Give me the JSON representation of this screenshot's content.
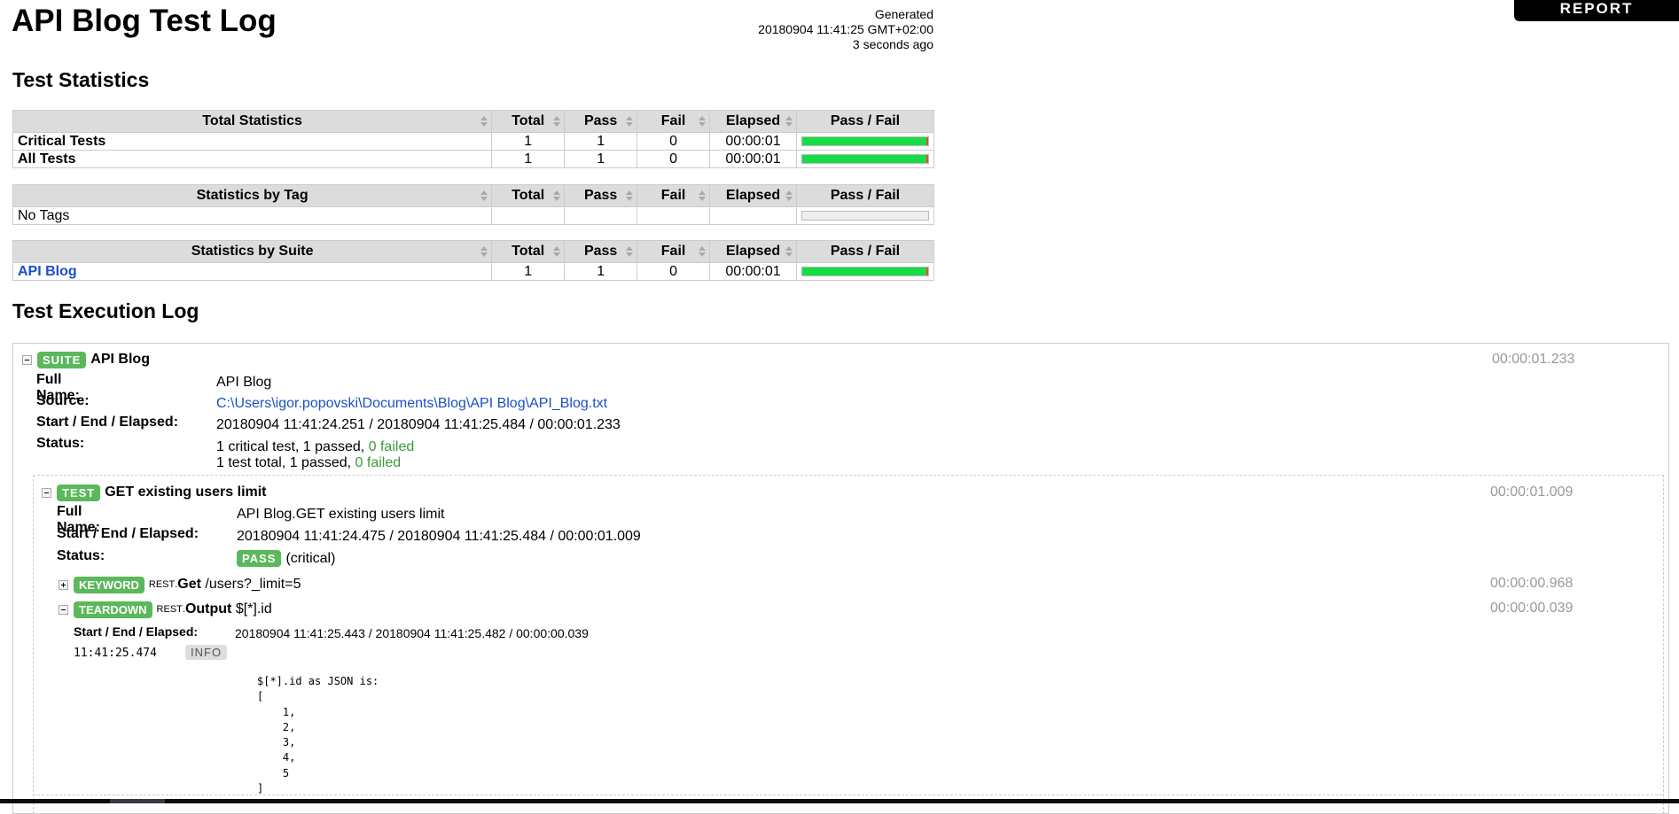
{
  "header": {
    "title": "API Blog Test Log",
    "generated_label": "Generated",
    "generated_timestamp": "20180904 11:41:25 GMT+02:00",
    "generated_ago": "3 seconds ago",
    "report_link": "REPORT"
  },
  "statistics": {
    "heading": "Test Statistics",
    "columns": [
      "Total",
      "Pass",
      "Fail",
      "Elapsed",
      "Pass / Fail"
    ],
    "total": {
      "title": "Total Statistics",
      "rows": [
        {
          "name": "Critical Tests",
          "total": "1",
          "pass": "1",
          "fail": "0",
          "elapsed": "00:00:01",
          "pass_fraction": 1.0
        },
        {
          "name": "All Tests",
          "total": "1",
          "pass": "1",
          "fail": "0",
          "elapsed": "00:00:01",
          "pass_fraction": 1.0
        }
      ]
    },
    "by_tag": {
      "title": "Statistics by Tag",
      "rows": [
        {
          "name": "No Tags",
          "total": "",
          "pass": "",
          "fail": "",
          "elapsed": "",
          "pass_fraction": null
        }
      ]
    },
    "by_suite": {
      "title": "Statistics by Suite",
      "rows": [
        {
          "name": "API Blog",
          "total": "1",
          "pass": "1",
          "fail": "0",
          "elapsed": "00:00:01",
          "pass_fraction": 1.0
        }
      ]
    }
  },
  "log": {
    "heading": "Test Execution Log",
    "suite": {
      "type_label": "SUITE",
      "name": "API Blog",
      "elapsed": "00:00:01.233",
      "full_name_key": "Full Name:",
      "full_name": "API Blog",
      "source_key": "Source:",
      "source": "C:\\Users\\igor.popovski\\Documents\\Blog\\API Blog\\API_Blog.txt",
      "times_key": "Start / End / Elapsed:",
      "times": "20180904 11:41:24.251 / 20180904 11:41:25.484 / 00:00:01.233",
      "status_key": "Status:",
      "status_line1_prefix": "1 critical test, 1 passed, ",
      "status_line1_failed": "0 failed",
      "status_line2_prefix": "1 test total, 1 passed, ",
      "status_line2_failed": "0 failed"
    },
    "test": {
      "type_label": "TEST",
      "name": "GET existing users limit",
      "elapsed": "00:00:01.009",
      "full_name_key": "Full Name:",
      "full_name": "API Blog.GET existing users limit",
      "times_key": "Start / End / Elapsed:",
      "times": "20180904 11:41:24.475 / 20180904 11:41:25.484 / 00:00:01.009",
      "status_key": "Status:",
      "status_badge": "PASS",
      "status_note": "(critical)"
    },
    "keyword": {
      "type_label": "KEYWORD",
      "library": "REST",
      "name": "Get",
      "args": "/users?_limit=5",
      "elapsed": "00:00:00.968"
    },
    "teardown": {
      "type_label": "TEARDOWN",
      "library": "REST",
      "name": "Output",
      "args": "$[*].id",
      "elapsed": "00:00:00.039",
      "times_key": "Start / End / Elapsed:",
      "times": "20180904 11:41:25.443 / 20180904 11:41:25.482 / 00:00:00.039",
      "message_time": "11:41:25.474",
      "message_level": "INFO",
      "message_text": "$[*].id as JSON is:\n[\n    1,\n    2,\n    3,\n    4,\n    5\n]"
    }
  },
  "colors": {
    "pass_green": "#16dd45",
    "label_green": "#5bb85b",
    "fail_red": "#ee4444",
    "link_blue": "#1a4fc8",
    "header_gray": "#dcdcdc"
  }
}
